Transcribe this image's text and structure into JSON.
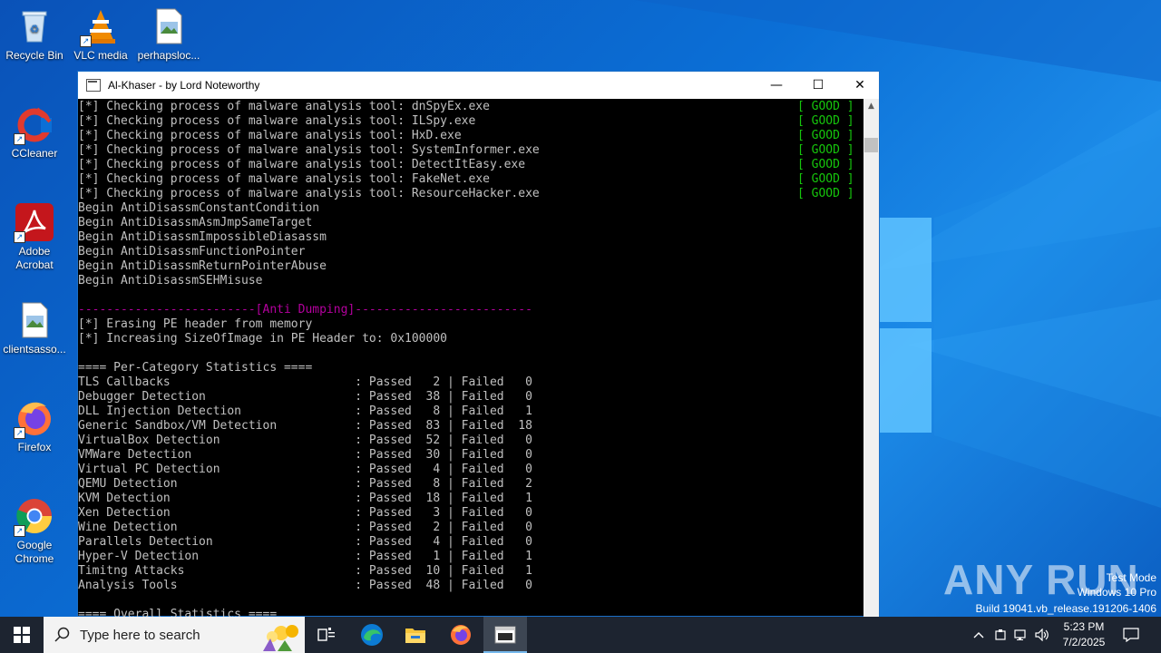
{
  "desktop": {
    "icons": [
      {
        "label": "Recycle Bin",
        "icon": "recycle-bin-icon"
      },
      {
        "label": "VLC media",
        "icon": "vlc-icon"
      },
      {
        "label": "perhapsloc...",
        "icon": "image-file-icon"
      },
      {
        "label": "CCleaner",
        "icon": "ccleaner-icon"
      },
      {
        "label": "Adobe Acrobat",
        "icon": "acrobat-icon"
      },
      {
        "label": "clientsasso...",
        "icon": "image-file-icon"
      },
      {
        "label": "Firefox",
        "icon": "firefox-icon"
      },
      {
        "label": "Google Chrome",
        "icon": "chrome-icon"
      }
    ],
    "watermark": {
      "mode": "Test Mode",
      "edition": "Windows 10 Pro",
      "build": "Build 19041.vb_release.191206-1406"
    },
    "anyrun_logo": "ANY RUN"
  },
  "window": {
    "title": "Al-Khaser - by Lord Noteworthy",
    "minimize": "—",
    "maximize": "☐",
    "close": "✕"
  },
  "console": {
    "checks": [
      {
        "text": "[*] Checking process of malware analysis tool: dnSpyEx.exe",
        "status": "[ GOOD ]"
      },
      {
        "text": "[*] Checking process of malware analysis tool: ILSpy.exe",
        "status": "[ GOOD ]"
      },
      {
        "text": "[*] Checking process of malware analysis tool: HxD.exe",
        "status": "[ GOOD ]"
      },
      {
        "text": "[*] Checking process of malware analysis tool: SystemInformer.exe",
        "status": "[ GOOD ]"
      },
      {
        "text": "[*] Checking process of malware analysis tool: DetectItEasy.exe",
        "status": "[ GOOD ]"
      },
      {
        "text": "[*] Checking process of malware analysis tool: FakeNet.exe",
        "status": "[ GOOD ]"
      },
      {
        "text": "[*] Checking process of malware analysis tool: ResourceHacker.exe",
        "status": "[ GOOD ]"
      }
    ],
    "begin_lines": [
      "Begin AntiDisassmConstantCondition",
      "Begin AntiDisassmAsmJmpSameTarget",
      "Begin AntiDisassmImpossibleDiasassm",
      "Begin AntiDisassmFunctionPointer",
      "Begin AntiDisassmReturnPointerAbuse",
      "Begin AntiDisassmSEHMisuse"
    ],
    "section_header": "-------------------------[Anti Dumping]-------------------------",
    "dump_lines": [
      "[*] Erasing PE header from memory",
      "[*] Increasing SizeOfImage in PE Header to: 0x100000"
    ],
    "stats_header": "==== Per-Category Statistics ====",
    "stats": [
      "TLS Callbacks                          : Passed   2 | Failed   0",
      "Debugger Detection                     : Passed  38 | Failed   0",
      "DLL Injection Detection                : Passed   8 | Failed   1",
      "Generic Sandbox/VM Detection           : Passed  83 | Failed  18",
      "VirtualBox Detection                   : Passed  52 | Failed   0",
      "VMWare Detection                       : Passed  30 | Failed   0",
      "Virtual PC Detection                   : Passed   4 | Failed   0",
      "QEMU Detection                         : Passed   8 | Failed   2",
      "KVM Detection                          : Passed  18 | Failed   1",
      "Xen Detection                          : Passed   3 | Failed   0",
      "Wine Detection                         : Passed   2 | Failed   0",
      "Parallels Detection                    : Passed   4 | Failed   0",
      "Hyper-V Detection                      : Passed   1 | Failed   1",
      "Timitng Attacks                        : Passed  10 | Failed   1",
      "Analysis Tools                         : Passed  48 | Failed   0"
    ],
    "overall_header": "==== Overall Statistics ===="
  },
  "taskbar": {
    "search_placeholder": "Type here to search",
    "apps": [
      "task-view-icon",
      "edge-icon",
      "file-explorer-icon",
      "firefox-icon",
      "console-app-icon"
    ],
    "time": "5:23 PM",
    "date": "7/2/2025"
  },
  "colors": {
    "good": "#16c60c",
    "section": "#b4009e",
    "console_text": "#c0c0c0"
  }
}
